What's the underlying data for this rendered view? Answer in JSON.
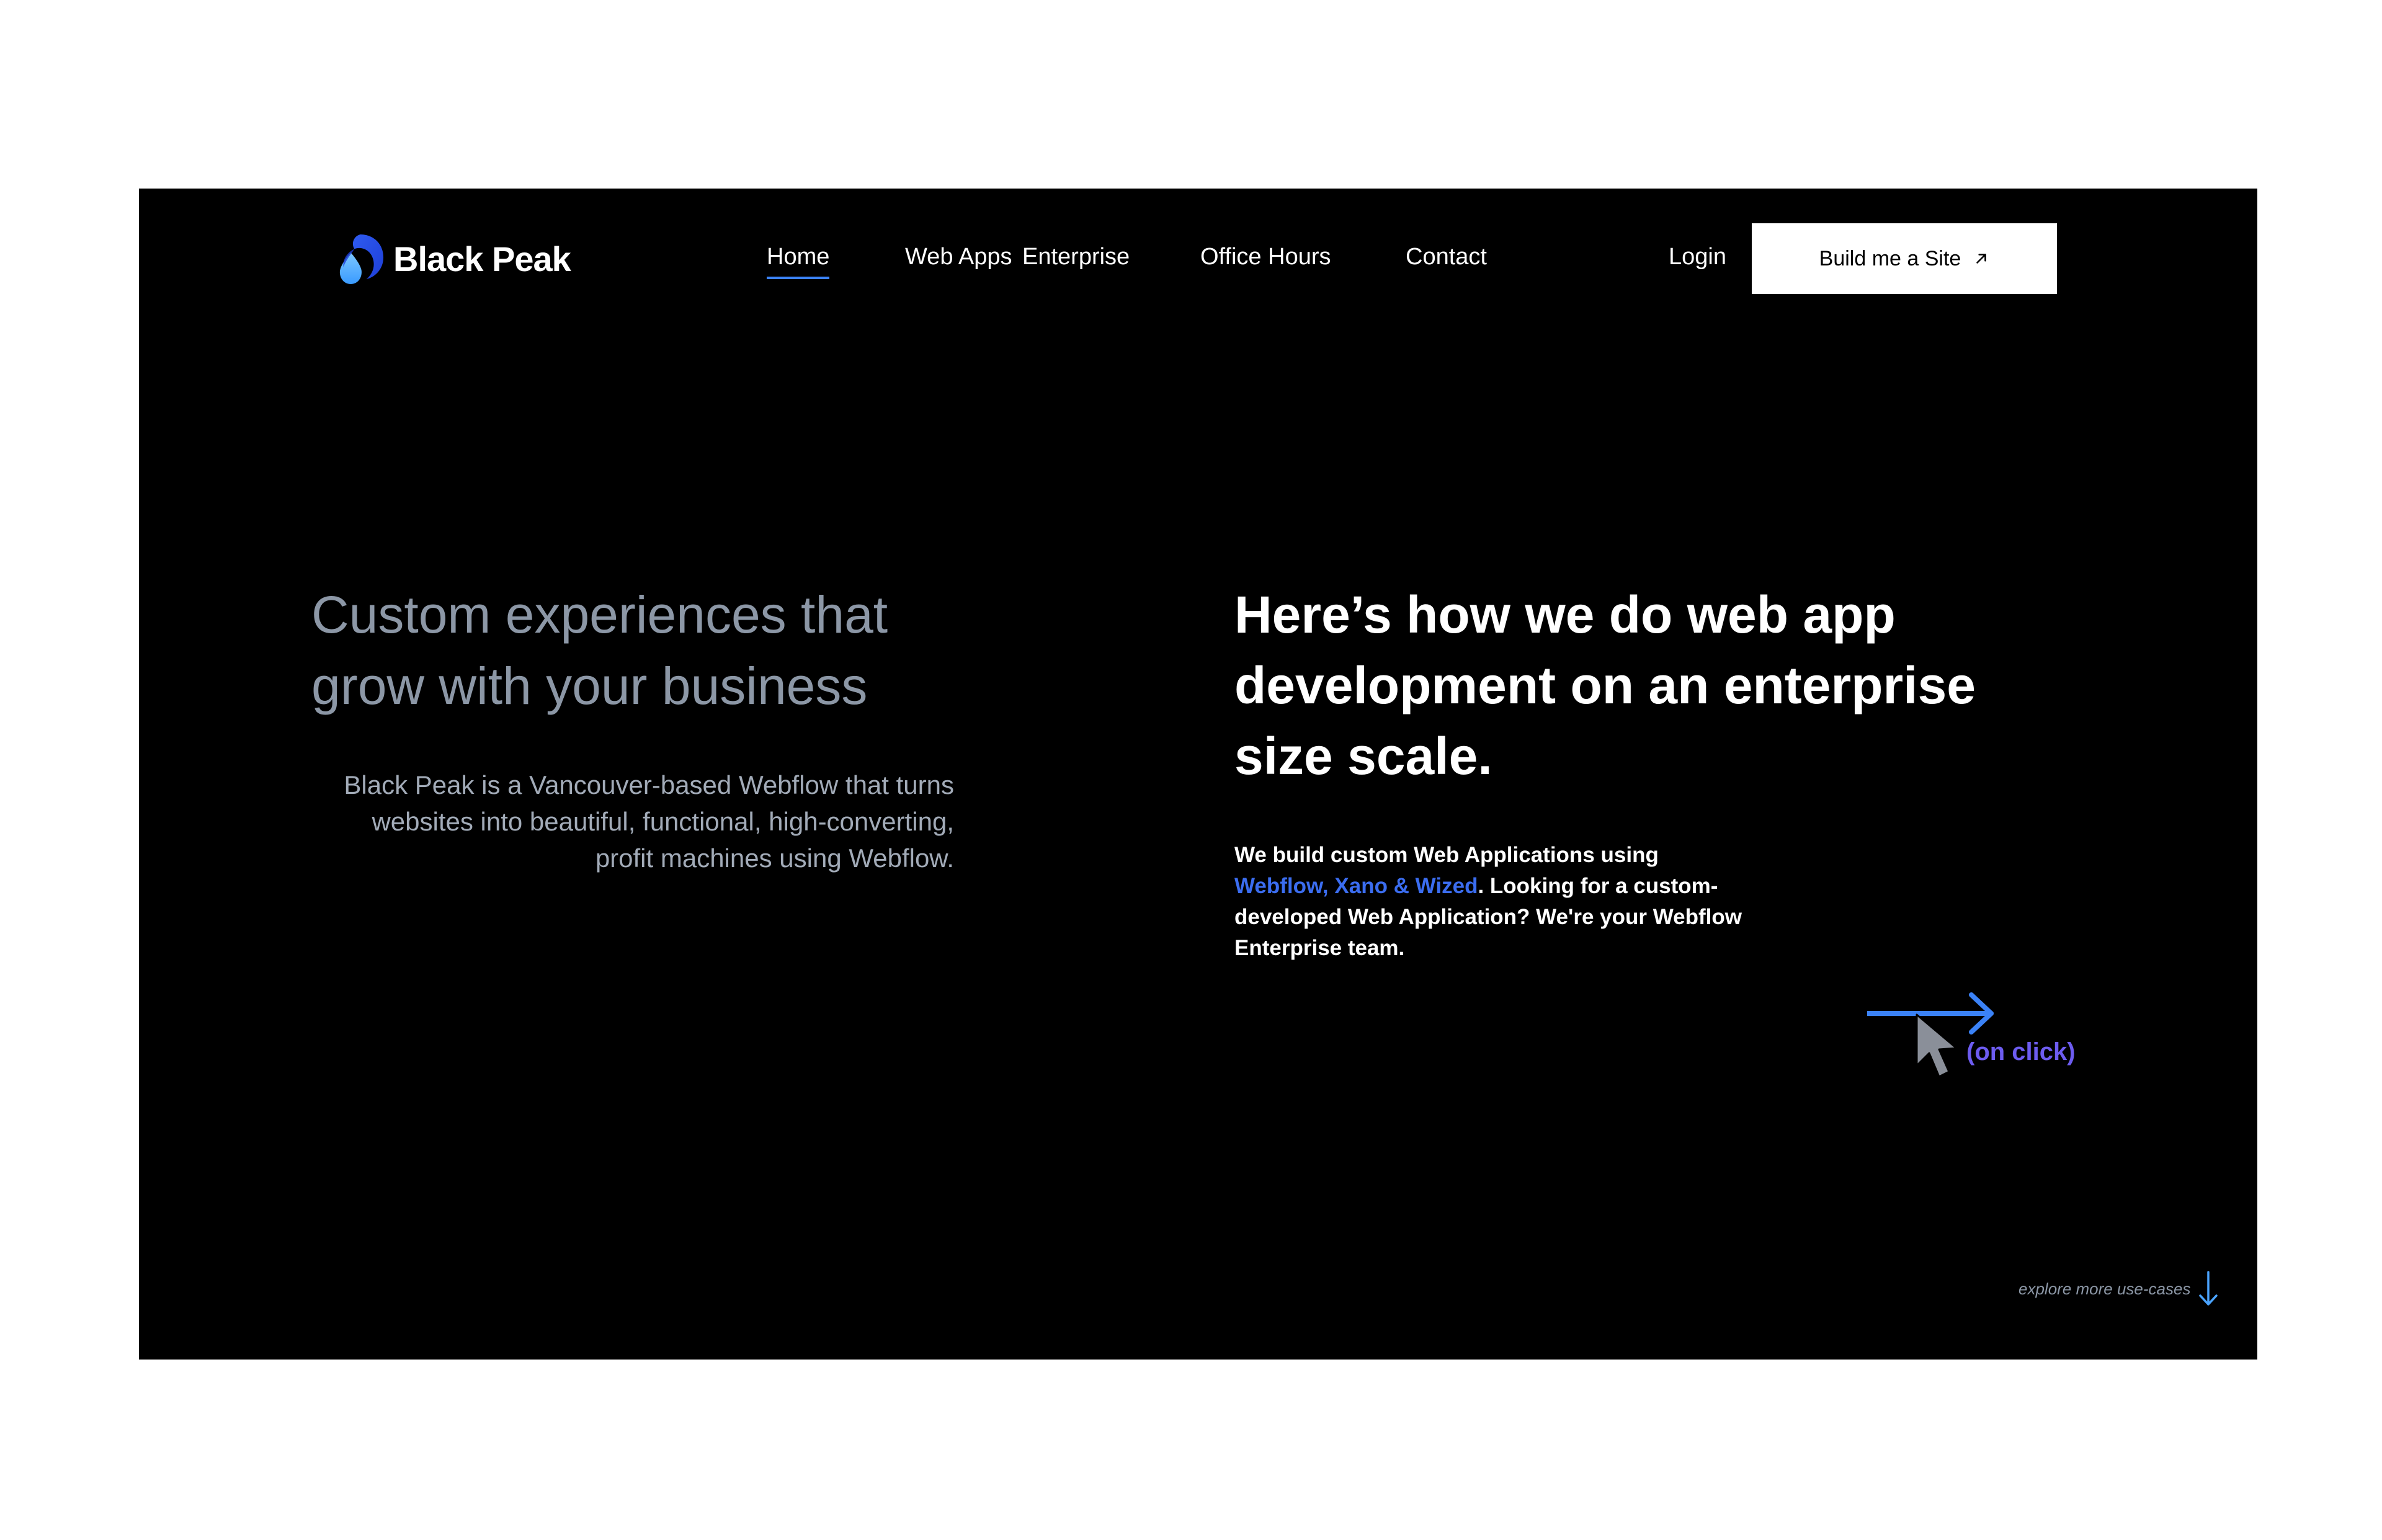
{
  "brand": {
    "name": "Black Peak",
    "accent_color": "#3b82f6"
  },
  "nav": {
    "items": [
      {
        "label": "Home",
        "active": true
      },
      {
        "label": "Web Apps",
        "active": false
      },
      {
        "label": "Enterprise",
        "active": false
      },
      {
        "label": "Office Hours",
        "active": false
      },
      {
        "label": "Contact",
        "active": false
      }
    ],
    "login_label": "Login",
    "cta_label": "Build me a Site",
    "cta_icon": "arrow-up-right-icon"
  },
  "hero_left": {
    "title": "Custom experiences that grow with your business",
    "description": "Black Peak is a Vancouver-based Webflow that turns websites into beautiful, functional, high-converting, profit machines using Webflow."
  },
  "hero_right": {
    "title": "Here’s how we do web app development on an enterprise size scale.",
    "desc_prefix": "We build custom Web Applications using ",
    "desc_tech": "Webflow, Xano & Wized",
    "desc_suffix": ". Looking for a custom-developed Web Application? We're your Webflow Enterprise team.",
    "tech_color": "#3b6df0"
  },
  "interaction": {
    "hint": "(on click)",
    "arrow_icon": "arrow-right-icon",
    "cursor_icon": "cursor-icon"
  },
  "explore": {
    "label": "explore more use-cases",
    "icon": "arrow-down-icon"
  }
}
